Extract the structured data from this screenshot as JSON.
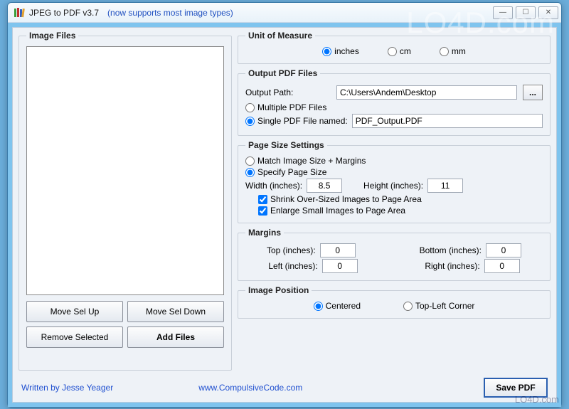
{
  "window": {
    "title": "JPEG to PDF  v3.7",
    "subtitle": "(now supports most image types)"
  },
  "watermark": "LO4D.com",
  "watermark2": "LO4D.com",
  "imageFiles": {
    "legend": "Image Files",
    "buttons": {
      "moveUp": "Move Sel Up",
      "moveDown": "Move Sel Down",
      "remove": "Remove Selected",
      "add": "Add Files"
    }
  },
  "unitOfMeasure": {
    "legend": "Unit of Measure",
    "inches": "inches",
    "cm": "cm",
    "mm": "mm",
    "selected": "inches"
  },
  "outputPdf": {
    "legend": "Output PDF Files",
    "pathLabel": "Output Path:",
    "pathValue": "C:\\Users\\Andem\\Desktop",
    "browseLabel": "...",
    "multiple": "Multiple PDF Files",
    "singleLabel": "Single PDF File named:",
    "singleValue": "PDF_Output.PDF",
    "selected": "single"
  },
  "pageSize": {
    "legend": "Page Size Settings",
    "matchLabel": "Match Image Size + Margins",
    "specifyLabel": "Specify Page Size",
    "selected": "specify",
    "widthLabel": "Width (inches):",
    "widthValue": "8.5",
    "heightLabel": "Height (inches):",
    "heightValue": "11",
    "shrinkLabel": "Shrink Over-Sized Images to Page Area",
    "enlargeLabel": "Enlarge Small Images to Page Area",
    "shrinkChecked": true,
    "enlargeChecked": true
  },
  "margins": {
    "legend": "Margins",
    "topLabel": "Top (inches):",
    "topValue": "0",
    "bottomLabel": "Bottom (inches):",
    "bottomValue": "0",
    "leftLabel": "Left (inches):",
    "leftValue": "0",
    "rightLabel": "Right (inches):",
    "rightValue": "0"
  },
  "imagePosition": {
    "legend": "Image Position",
    "centered": "Centered",
    "topLeft": "Top-Left Corner",
    "selected": "centered"
  },
  "footer": {
    "author": "Written by Jesse Yeager",
    "site": "www.CompulsiveCode.com",
    "save": "Save PDF"
  }
}
